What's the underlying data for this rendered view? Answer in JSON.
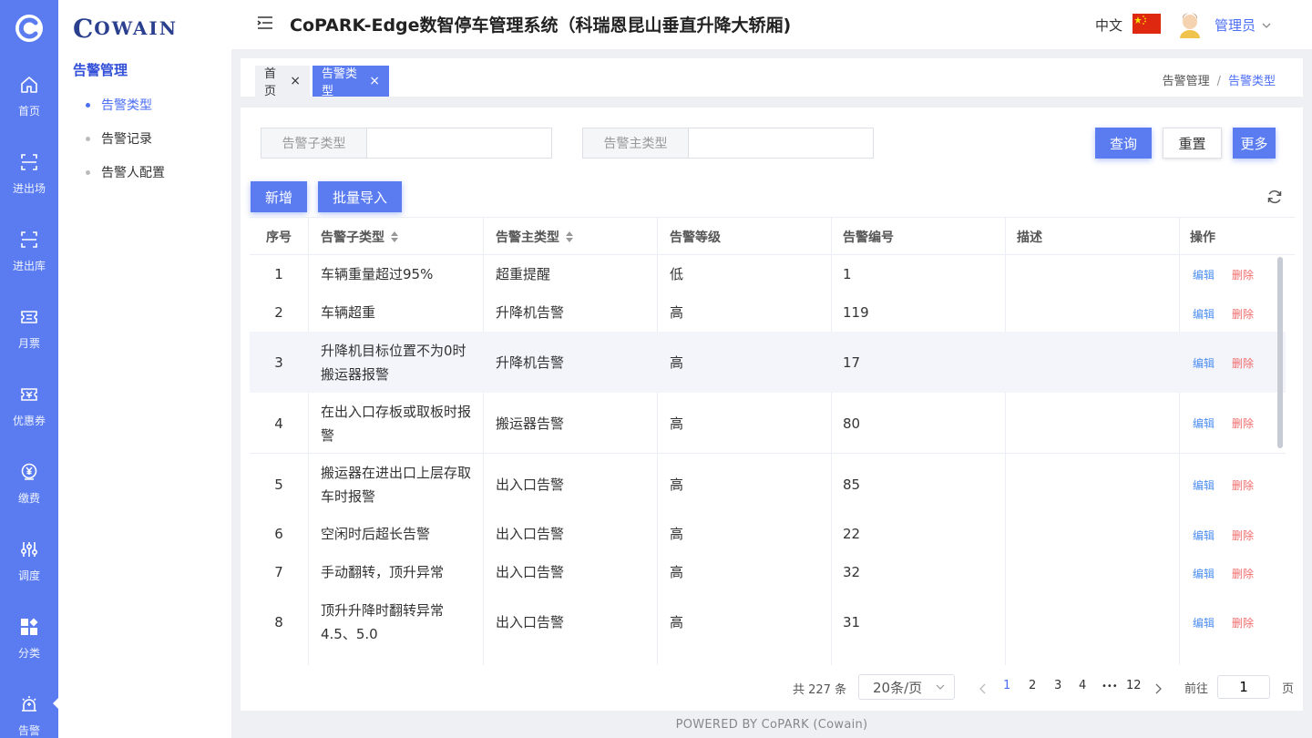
{
  "nav": {
    "items": [
      {
        "label": "首页",
        "icon": "home-icon"
      },
      {
        "label": "进出场",
        "icon": "scan-icon"
      },
      {
        "label": "进出库",
        "icon": "scan-icon"
      },
      {
        "label": "月票",
        "icon": "ticket-icon"
      },
      {
        "label": "优惠券",
        "icon": "coupon-icon"
      },
      {
        "label": "缴费",
        "icon": "payment-icon"
      },
      {
        "label": "调度",
        "icon": "sliders-icon"
      },
      {
        "label": "分类",
        "icon": "category-icon"
      },
      {
        "label": "告警",
        "icon": "alarm-icon"
      }
    ]
  },
  "brand": {
    "name_big": "C",
    "name_rest": "OWAIN"
  },
  "submenu": {
    "title": "告警管理",
    "items": [
      {
        "label": "告警类型"
      },
      {
        "label": "告警记录"
      },
      {
        "label": "告警人配置"
      }
    ]
  },
  "header": {
    "title": "CoPARK-Edge数智停车管理系统（科瑞恩昆山垂直升降大轿厢)",
    "lang": "中文",
    "user": "管理员"
  },
  "tabs": {
    "home": "首页",
    "current": "告警类型",
    "close": "×"
  },
  "breadcrumb": {
    "parent": "告警管理",
    "sep": "/",
    "current": "告警类型"
  },
  "filters": {
    "sub_type_label": "告警子类型",
    "sub_type_value": "",
    "main_type_label": "告警主类型",
    "main_type_value": "",
    "query": "查询",
    "reset": "重置",
    "more": "更多"
  },
  "actions": {
    "add": "新增",
    "import": "批量导入"
  },
  "table": {
    "headers": [
      "序号",
      "告警子类型",
      "告警主类型",
      "告警等级",
      "告警编号",
      "描述",
      "操作"
    ],
    "edit_label": "编辑",
    "delete_label": "删除",
    "rows": [
      {
        "no": "1",
        "sub": "车辆重量超过95%",
        "main": "超重提醒",
        "level": "低",
        "code": "1",
        "desc": ""
      },
      {
        "no": "2",
        "sub": "车辆超重",
        "main": "升降机告警",
        "level": "高",
        "code": "119",
        "desc": ""
      },
      {
        "no": "3",
        "sub": "升降机目标位置不为0时搬运器报警",
        "main": "升降机告警",
        "level": "高",
        "code": "17",
        "desc": ""
      },
      {
        "no": "4",
        "sub": "在出入口存板或取板时报警",
        "main": "搬运器告警",
        "level": "高",
        "code": "80",
        "desc": ""
      },
      {
        "no": "5",
        "sub": "搬运器在进出口上层存取车时报警",
        "main": "出入口告警",
        "level": "高",
        "code": "85",
        "desc": ""
      },
      {
        "no": "6",
        "sub": "空闲时后超长告警",
        "main": "出入口告警",
        "level": "高",
        "code": "22",
        "desc": ""
      },
      {
        "no": "7",
        "sub": "手动翻转，顶升异常",
        "main": "出入口告警",
        "level": "高",
        "code": "32",
        "desc": ""
      },
      {
        "no": "8",
        "sub": "顶升升降时翻转异常4.5、5.0",
        "main": "出入口告警",
        "level": "高",
        "code": "31",
        "desc": ""
      }
    ]
  },
  "pagination": {
    "total": "共 227 条",
    "page_size": "20条/页",
    "pages": [
      "1",
      "2",
      "3",
      "4",
      "•••",
      "12"
    ],
    "current": "1",
    "goto_label": "前往",
    "goto_value": "1",
    "page_unit": "页"
  },
  "footer": "POWERED BY CoPARK (Cowain)",
  "colors": {
    "primary": "#5b7cf0",
    "link": "#4c6ef5",
    "danger": "#f06b6b"
  }
}
